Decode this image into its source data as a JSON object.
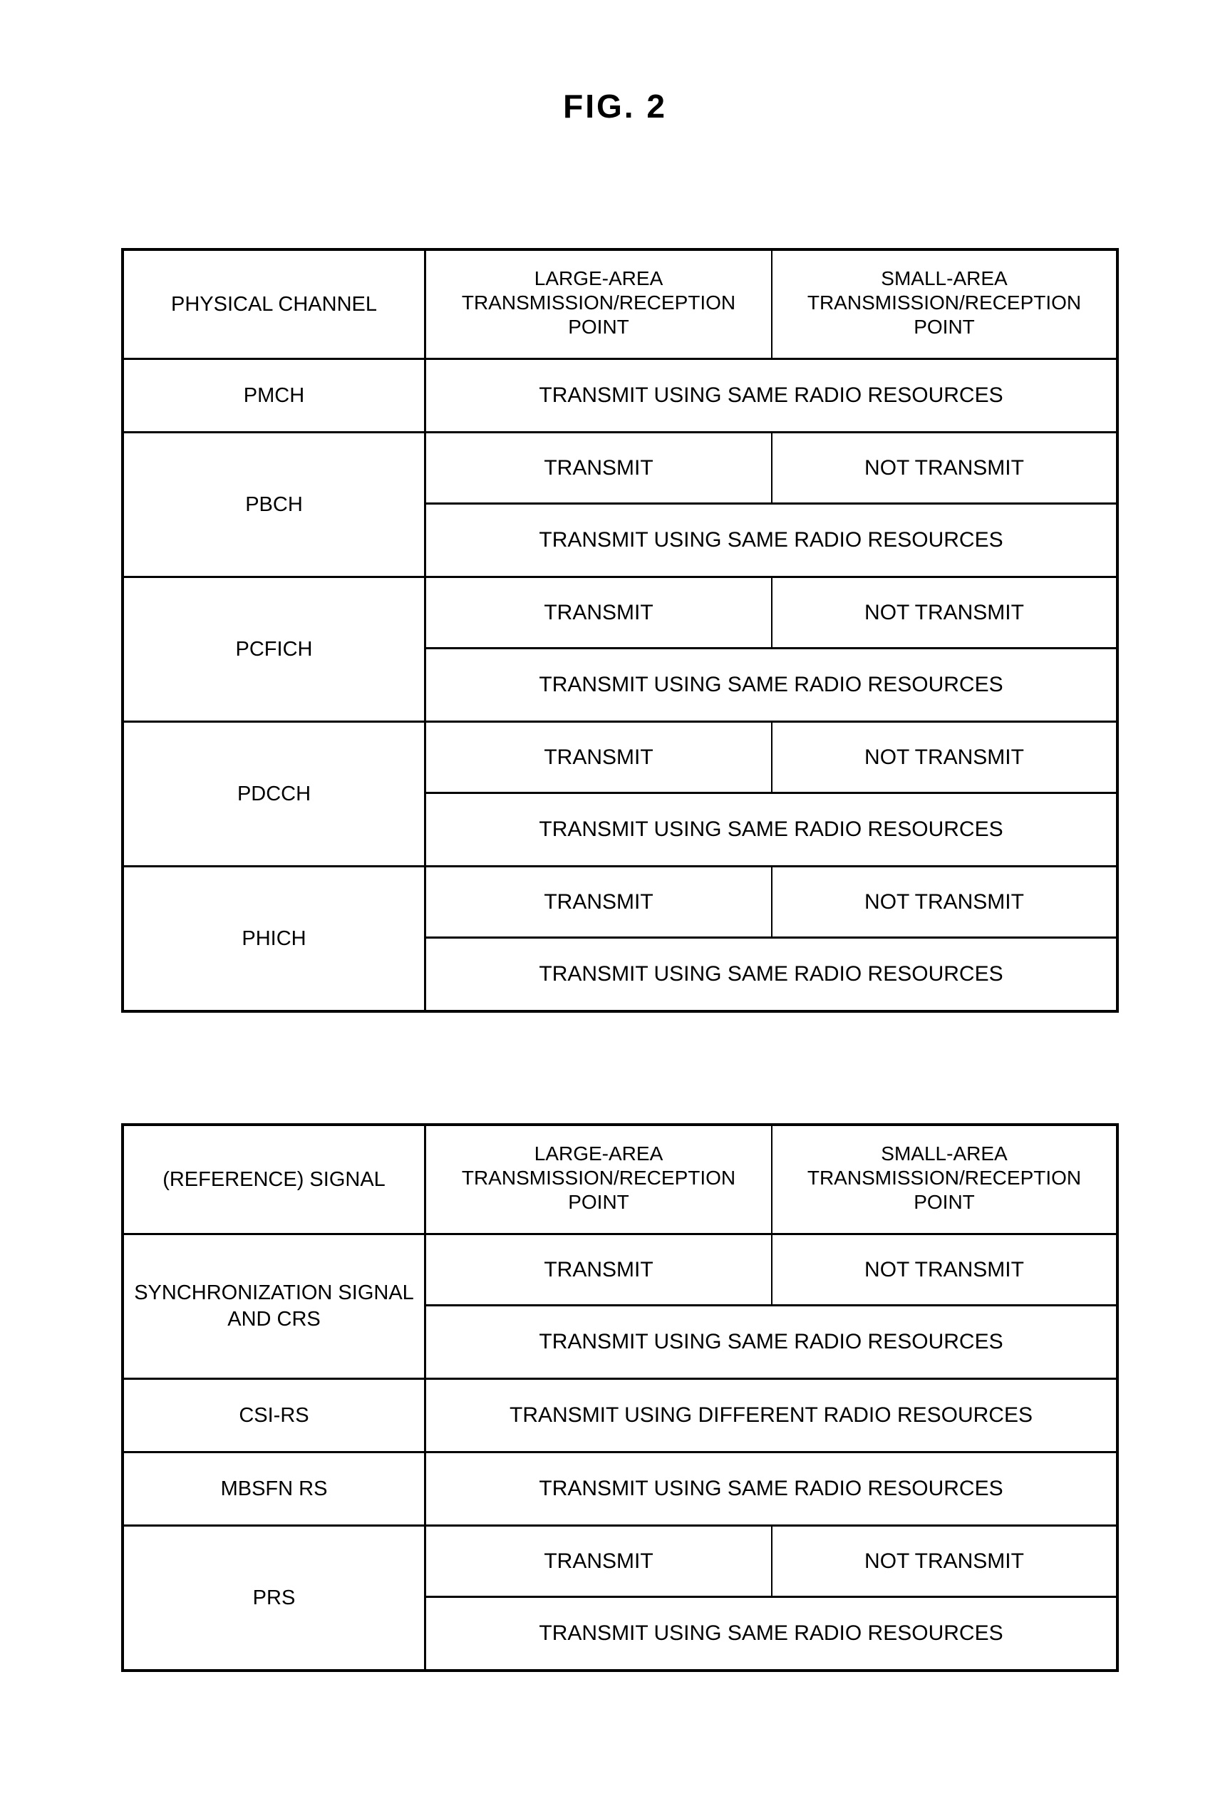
{
  "figure": {
    "title": "FIG. 2"
  },
  "tables": [
    {
      "id": "physical-channel-table",
      "header": {
        "col1": "PHYSICAL CHANNEL",
        "col2_line1": "LARGE-AREA",
        "col2_line2": "TRANSMISSION/RECEPTION",
        "col2_line3": "POINT",
        "col3_line1": "SMALL-AREA",
        "col3_line2": "TRANSMISSION/RECEPTION",
        "col3_line3": "POINT"
      },
      "rows": [
        {
          "label": "PMCH",
          "type": "full-only",
          "full": "TRANSMIT USING SAME RADIO RESOURCES"
        },
        {
          "label": "PBCH",
          "type": "split-then-full",
          "large": "TRANSMIT",
          "small": "NOT TRANSMIT",
          "full": "TRANSMIT USING SAME RADIO RESOURCES"
        },
        {
          "label": "PCFICH",
          "type": "split-then-full",
          "large": "TRANSMIT",
          "small": "NOT TRANSMIT",
          "full": "TRANSMIT USING SAME RADIO RESOURCES"
        },
        {
          "label": "PDCCH",
          "type": "split-then-full",
          "large": "TRANSMIT",
          "small": "NOT TRANSMIT",
          "full": "TRANSMIT USING SAME RADIO RESOURCES"
        },
        {
          "label": "PHICH",
          "type": "split-then-full",
          "large": "TRANSMIT",
          "small": "NOT TRANSMIT",
          "full": "TRANSMIT USING SAME RADIO RESOURCES"
        }
      ]
    },
    {
      "id": "reference-signal-table",
      "header": {
        "col1": "(REFERENCE) SIGNAL",
        "col2_line1": "LARGE-AREA",
        "col2_line2": "TRANSMISSION/RECEPTION",
        "col2_line3": "POINT",
        "col3_line1": "SMALL-AREA",
        "col3_line2": "TRANSMISSION/RECEPTION",
        "col3_line3": "POINT"
      },
      "rows": [
        {
          "label": "SYNCHRONIZATION SIGNAL AND CRS",
          "type": "split-then-full",
          "large": "TRANSMIT",
          "small": "NOT TRANSMIT",
          "full": "TRANSMIT USING SAME RADIO RESOURCES"
        },
        {
          "label": "CSI-RS",
          "type": "full-only",
          "full": "TRANSMIT USING DIFFERENT RADIO RESOURCES"
        },
        {
          "label": "MBSFN RS",
          "type": "full-only",
          "full": "TRANSMIT USING SAME RADIO RESOURCES"
        },
        {
          "label": "PRS",
          "type": "split-then-full",
          "large": "TRANSMIT",
          "small": "NOT TRANSMIT",
          "full": "TRANSMIT USING SAME RADIO RESOURCES"
        }
      ]
    }
  ]
}
